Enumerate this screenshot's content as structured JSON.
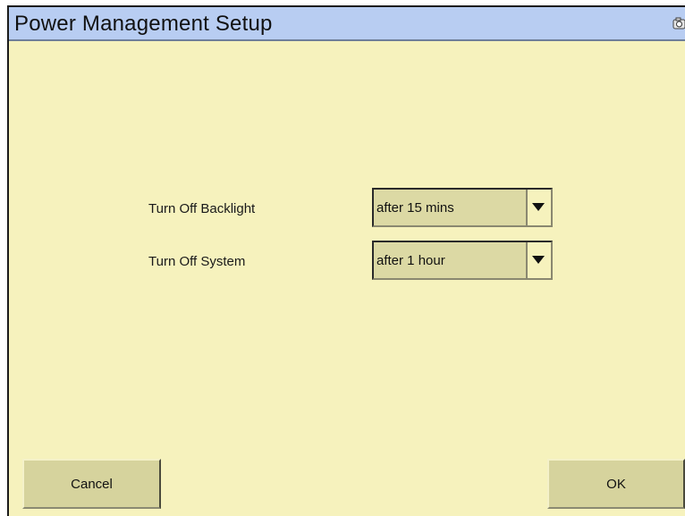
{
  "window": {
    "title": "Power Management Setup",
    "title_icon": "camera-icon"
  },
  "settings": [
    {
      "label": "Turn Off Backlight",
      "value": "after 15 mins"
    },
    {
      "label": "Turn Off System",
      "value": "after 1 hour"
    }
  ],
  "buttons": {
    "cancel_label": "Cancel",
    "ok_label": "OK"
  },
  "colors": {
    "background": "#f6f2bd",
    "titlebar": "#b8cdf2",
    "control": "#dcd9a4",
    "button": "#d6d39d"
  }
}
